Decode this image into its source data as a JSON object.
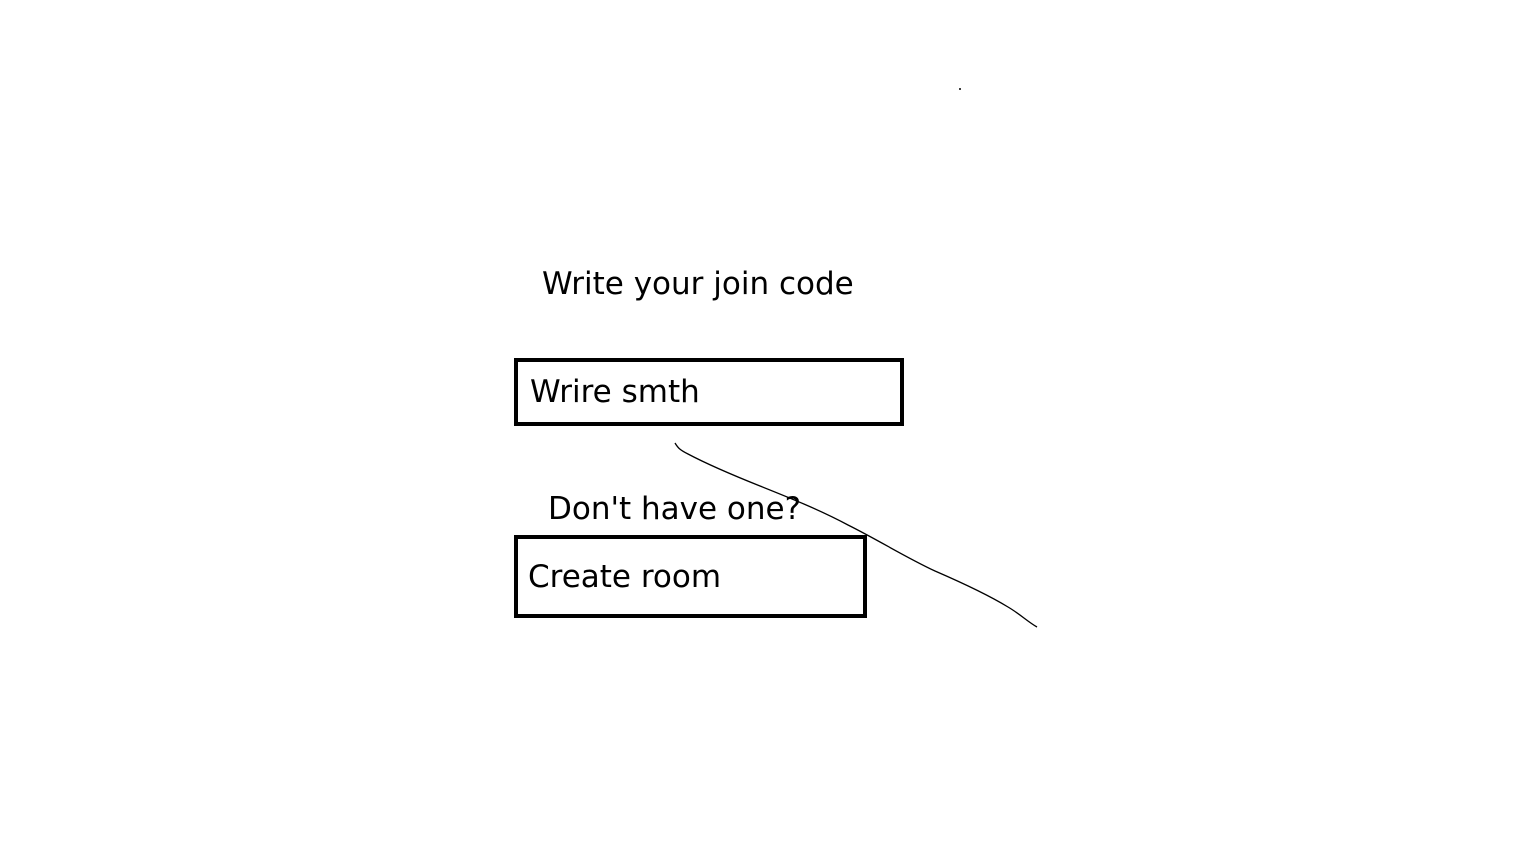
{
  "join": {
    "prompt": "Write your join code",
    "input_placeholder": "Wrire smth"
  },
  "create": {
    "prompt": "Don't have one?",
    "button_label": "Create room"
  }
}
